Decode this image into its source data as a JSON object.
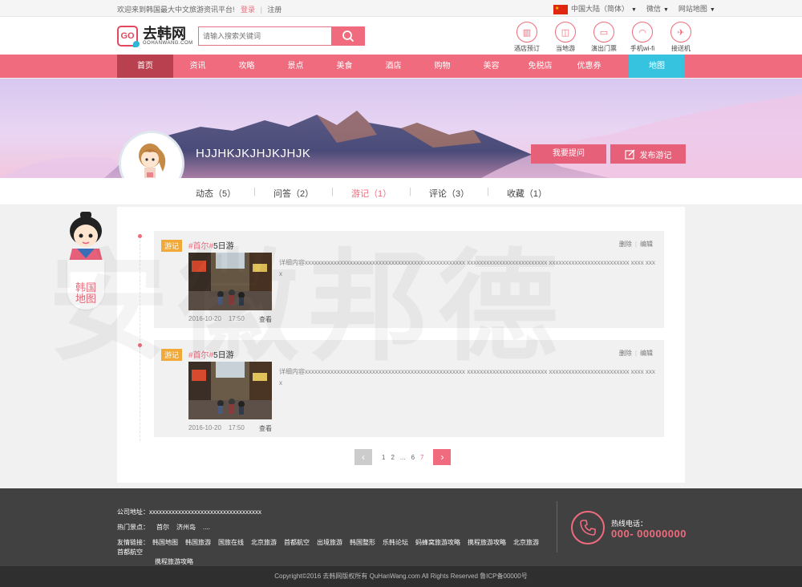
{
  "topbar": {
    "welcome": "欢迎来到韩国最大中文旅游资讯平台!",
    "login": "登录",
    "register": "注册",
    "region": "中国大陆（简体）",
    "weixin": "微信",
    "sitemap": "网站地图"
  },
  "header": {
    "logo_cn": "去韩网",
    "logo_en": "GOHANWANG.COM",
    "search_placeholder": "请输入搜索关键词",
    "quick": [
      "酒店预订",
      "当地游",
      "演出门票",
      "手机wi-fi",
      "接送机"
    ]
  },
  "nav": {
    "items": [
      "首页",
      "资讯",
      "攻略",
      "景点",
      "美食",
      "酒店",
      "购物",
      "美容",
      "免税店",
      "优惠券"
    ],
    "map": "地图"
  },
  "profile": {
    "username": "HJJHKJKJHJKJHJK",
    "ask_button": "我要提问",
    "publish_button": "发布游记"
  },
  "tabs": [
    {
      "label": "动态（5）",
      "active": false
    },
    {
      "label": "问答（2）",
      "active": false
    },
    {
      "label": "游记（1）",
      "active": true
    },
    {
      "label": "评论（3）",
      "active": false
    },
    {
      "label": "收藏（1）",
      "active": false
    }
  ],
  "side_badge": {
    "line1": "韩国",
    "line2": "地图"
  },
  "watermark": "安徽邦德",
  "entries": [
    {
      "tag": "游记",
      "hash": "#首尔#",
      "title": "5日游",
      "delete": "删除",
      "edit": "编辑",
      "desc": "详细内容xxxxxxxxxxxxxxxxxxxxxxxxxxxxxxxxxxxxxxxxxxxxxxxxxx xxxxxxxxxxxxxxxxxxxxxxxxx xxxxxxxxxxxxxxxxxxxxxxxxx xxxx xxxx",
      "date": "2016-10-20",
      "time": "17:50",
      "view": "查看"
    },
    {
      "tag": "游记",
      "hash": "#首尔#",
      "title": "5日游",
      "delete": "删除",
      "edit": "编辑",
      "desc": "详细内容xxxxxxxxxxxxxxxxxxxxxxxxxxxxxxxxxxxxxxxxxxxxxxxxxx xxxxxxxxxxxxxxxxxxxxxxxxx xxxxxxxxxxxxxxxxxxxxxxxxx xxxx xxxx",
      "date": "2016-10-20",
      "time": "17:50",
      "view": "查看"
    }
  ],
  "pager": {
    "pages": [
      "1",
      "2",
      "...",
      "6",
      "7"
    ],
    "current": "7"
  },
  "footer": {
    "address": "公司地址：xxxxxxxxxxxxxxxxxxxxxxxxxxxxxxxxxxx",
    "hot_label": "热门景点：",
    "hot": [
      "首尔",
      "济州岛",
      "...."
    ],
    "links_label": "友情链接：",
    "links": [
      "韩国地图",
      "韩国旅游",
      "国旅在线",
      "北京旅游",
      "首都航空",
      "出境旅游",
      "韩国整形",
      "乐韩论坛",
      "蚂蜂窝旅游攻略",
      "携程旅游攻略",
      "北京旅游",
      "首都航空",
      "携程旅游攻略"
    ],
    "hotline_label": "热线电话：",
    "hotline": "000- 00000000",
    "copyright": "Copyright©2016 去韩网版权所有 QuHanWang.com All Rights Reserved 鲁ICP备00000号"
  },
  "colors": {
    "brand": "#ef6b7d",
    "nav_active": "#b9404f",
    "map": "#35c3e0",
    "tag": "#f1a93a",
    "footer": "#414141"
  }
}
